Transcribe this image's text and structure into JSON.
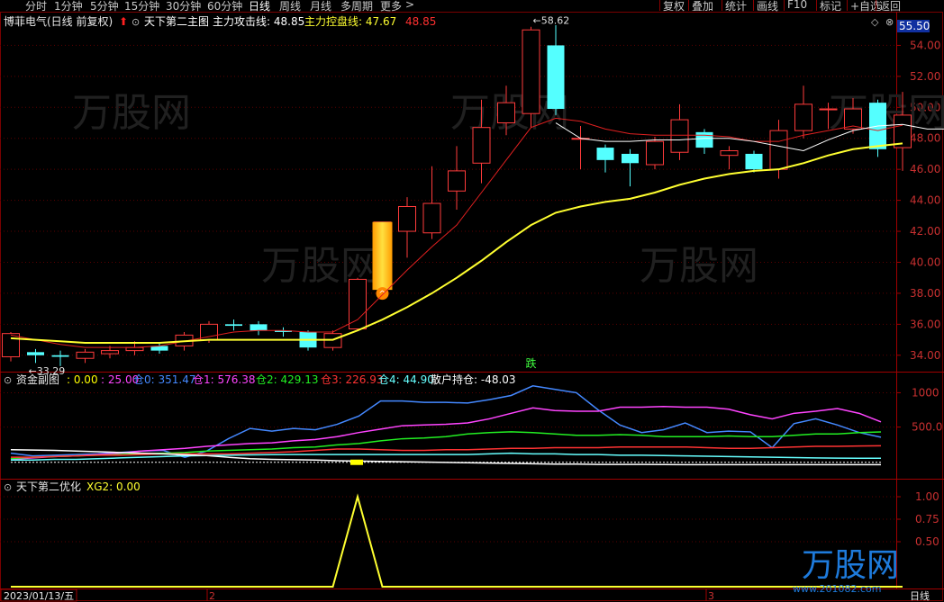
{
  "toolbar": {
    "tabs": [
      "分时",
      "1分钟",
      "5分钟",
      "15分钟",
      "30分钟",
      "60分钟",
      "日线",
      "周线",
      "月线",
      "多周期",
      "更多"
    ],
    "active_tab": "日线",
    "right_buttons": [
      "复权",
      "叠加",
      "统计",
      "画线",
      "F10",
      "标记",
      "+自选",
      "返回"
    ]
  },
  "main_panel": {
    "stock_title": "博菲电气(日线 前复权)",
    "indicator_name": "天下第二主图",
    "attack_label": "主力攻击线: 48.85",
    "control_label": "主力控盘线: 47.67",
    "extra_value": "48.85",
    "price_box": "55.50",
    "y_ticks": [
      "54.00",
      "52.00",
      "50.00",
      "48.00",
      "46.00",
      "44.00",
      "42.00",
      "40.00",
      "38.00",
      "36.00",
      "34.00"
    ],
    "high_note": "58.62",
    "low_note": "33.29",
    "signal_text": "跌"
  },
  "fund_panel": {
    "title": "资金副图",
    "items": [
      {
        "text": ": 0.00",
        "color": "#ffff00"
      },
      {
        "text": ": 25.00",
        "color": "#ff44ff"
      },
      {
        "text": "仓0: 351.47",
        "color": "#4488ff"
      },
      {
        "text": "仓1: 576.38",
        "color": "#ff44ff"
      },
      {
        "text": "仓2: 429.13",
        "color": "#22ee22"
      },
      {
        "text": "仓3: 226.93",
        "color": "#ff3333"
      },
      {
        "text": "仓4: 44.90",
        "color": "#66ffff"
      },
      {
        "text": "散户持仓: -48.03",
        "color": "#ffffff"
      }
    ],
    "y_ticks": [
      "1000",
      "500.0"
    ]
  },
  "opt_panel": {
    "title": "天下第二优化",
    "xg_label": "XG2: 0.00",
    "y_ticks": [
      "1.00",
      "0.75",
      "0.50"
    ]
  },
  "bottom_axis": {
    "date_label": "2023/01/13/五",
    "markers": [
      "2",
      "3"
    ],
    "period": "日线"
  },
  "watermark": {
    "brand": "万股网",
    "url": "www.201082.com"
  },
  "chart_data": {
    "type": "candlestick",
    "ylim": [
      33,
      56
    ],
    "candles": [
      {
        "o": 33.9,
        "c": 35.4,
        "h": 35.5,
        "l": 33.6
      },
      {
        "o": 34.2,
        "c": 34.0,
        "h": 34.4,
        "l": 33.5
      },
      {
        "o": 34.0,
        "c": 33.9,
        "h": 34.3,
        "l": 33.3
      },
      {
        "o": 33.8,
        "c": 34.2,
        "h": 34.4,
        "l": 33.5
      },
      {
        "o": 34.1,
        "c": 34.3,
        "h": 34.6,
        "l": 33.8
      },
      {
        "o": 34.3,
        "c": 34.5,
        "h": 34.9,
        "l": 34.0
      },
      {
        "o": 34.6,
        "c": 34.3,
        "h": 34.8,
        "l": 34.1
      },
      {
        "o": 34.6,
        "c": 35.3,
        "h": 35.5,
        "l": 34.3
      },
      {
        "o": 35.0,
        "c": 36.0,
        "h": 36.2,
        "l": 34.8
      },
      {
        "o": 36.0,
        "c": 35.9,
        "h": 36.3,
        "l": 35.6
      },
      {
        "o": 36.0,
        "c": 35.6,
        "h": 36.2,
        "l": 35.3
      },
      {
        "o": 35.6,
        "c": 35.5,
        "h": 35.8,
        "l": 35.2
      },
      {
        "o": 35.5,
        "c": 34.5,
        "h": 35.6,
        "l": 34.3
      },
      {
        "o": 34.5,
        "c": 35.4,
        "h": 35.6,
        "l": 34.3
      },
      {
        "o": 35.7,
        "c": 38.9,
        "h": 39.0,
        "l": 35.6
      },
      {
        "o": 38.8,
        "c": 42.6,
        "h": 42.6,
        "l": 38.5
      },
      {
        "o": 42.0,
        "c": 43.6,
        "h": 44.2,
        "l": 40.3
      },
      {
        "o": 41.9,
        "c": 43.8,
        "h": 46.2,
        "l": 41.5
      },
      {
        "o": 44.6,
        "c": 45.9,
        "h": 47.5,
        "l": 43.4
      },
      {
        "o": 46.4,
        "c": 48.7,
        "h": 50.5,
        "l": 45.1
      },
      {
        "o": 49.0,
        "c": 50.3,
        "h": 51.4,
        "l": 48.2
      },
      {
        "o": 49.6,
        "c": 55.0,
        "h": 55.2,
        "l": 48.7
      },
      {
        "o": 54.0,
        "c": 49.9,
        "h": 55.3,
        "l": 49.5
      },
      {
        "o": 48.0,
        "c": 48.0,
        "h": 48.8,
        "l": 46.0
      },
      {
        "o": 47.4,
        "c": 46.6,
        "h": 47.6,
        "l": 45.8
      },
      {
        "o": 47.0,
        "c": 46.4,
        "h": 47.3,
        "l": 44.9
      },
      {
        "o": 46.3,
        "c": 47.8,
        "h": 48.1,
        "l": 46.0
      },
      {
        "o": 47.1,
        "c": 49.2,
        "h": 50.2,
        "l": 46.6
      },
      {
        "o": 48.4,
        "c": 47.4,
        "h": 48.6,
        "l": 47.0
      },
      {
        "o": 46.9,
        "c": 47.2,
        "h": 47.5,
        "l": 46.0
      },
      {
        "o": 47.0,
        "c": 46.0,
        "h": 47.2,
        "l": 45.8
      },
      {
        "o": 46.0,
        "c": 48.5,
        "h": 49.2,
        "l": 45.4
      },
      {
        "o": 48.5,
        "c": 50.2,
        "h": 51.4,
        "l": 48.0
      },
      {
        "o": 49.9,
        "c": 49.9,
        "h": 50.3,
        "l": 48.6
      },
      {
        "o": 48.6,
        "c": 49.9,
        "h": 50.6,
        "l": 48.3
      },
      {
        "o": 50.3,
        "c": 47.3,
        "h": 50.5,
        "l": 46.8
      },
      {
        "o": 47.4,
        "c": 49.5,
        "h": 51.0,
        "l": 45.9
      }
    ],
    "attack_line": [
      35.3,
      35.0,
      34.7,
      34.5,
      34.5,
      34.5,
      34.6,
      34.9,
      35.2,
      35.5,
      35.6,
      35.6,
      35.5,
      35.5,
      36.3,
      37.9,
      39.5,
      41.0,
      42.4,
      44.5,
      46.6,
      48.7,
      49.3,
      49.1,
      48.6,
      48.3,
      48.2,
      48.2,
      48.2,
      48.1,
      47.8,
      47.8,
      48.2,
      48.5,
      48.8,
      48.5,
      48.85
    ],
    "control_line": [
      35.1,
      35.0,
      34.9,
      34.8,
      34.8,
      34.8,
      34.8,
      34.9,
      35.0,
      35.0,
      35.0,
      35.0,
      35.0,
      35.0,
      35.6,
      36.3,
      37.1,
      38.0,
      39.0,
      40.1,
      41.3,
      42.4,
      43.2,
      43.6,
      43.9,
      44.1,
      44.5,
      45.0,
      45.4,
      45.7,
      45.9,
      46.0,
      46.4,
      46.9,
      47.3,
      47.5,
      47.67
    ],
    "fund_ylim": [
      -200,
      1150
    ],
    "fund_series": [
      {
        "name": "仓0",
        "color": "#4488ff",
        "values": [
          120,
          80,
          90,
          100,
          110,
          130,
          150,
          160,
          60,
          150,
          330,
          480,
          440,
          480,
          460,
          540,
          660,
          880,
          880,
          860,
          860,
          850,
          900,
          960,
          1100,
          1050,
          1000,
          750,
          530,
          420,
          460,
          560,
          420,
          440,
          430,
          200,
          550,
          620,
          530,
          420,
          352
        ]
      },
      {
        "name": "仓1",
        "color": "#ff44ff",
        "values": [
          30,
          50,
          70,
          80,
          100,
          120,
          150,
          170,
          190,
          220,
          240,
          260,
          270,
          300,
          320,
          360,
          420,
          470,
          520,
          530,
          540,
          560,
          620,
          700,
          780,
          740,
          730,
          730,
          790,
          790,
          800,
          790,
          790,
          760,
          680,
          620,
          700,
          730,
          770,
          700,
          576
        ]
      },
      {
        "name": "仓2",
        "color": "#22ee22",
        "values": [
          40,
          60,
          70,
          80,
          90,
          100,
          110,
          120,
          130,
          150,
          160,
          170,
          180,
          200,
          210,
          240,
          260,
          300,
          330,
          340,
          360,
          400,
          420,
          430,
          420,
          400,
          380,
          380,
          390,
          380,
          360,
          360,
          360,
          370,
          360,
          360,
          380,
          400,
          400,
          420,
          429
        ]
      },
      {
        "name": "仓3",
        "color": "#ff3333",
        "values": [
          60,
          60,
          70,
          80,
          90,
          90,
          100,
          110,
          110,
          110,
          110,
          120,
          130,
          140,
          160,
          180,
          180,
          170,
          160,
          160,
          170,
          170,
          180,
          190,
          190,
          200,
          200,
          200,
          210,
          210,
          210,
          210,
          200,
          190,
          190,
          200,
          210,
          220,
          220,
          225,
          227
        ]
      },
      {
        "name": "仓4",
        "color": "#66ffff",
        "values": [
          20,
          20,
          30,
          30,
          40,
          50,
          60,
          70,
          80,
          85,
          90,
          95,
          98,
          100,
          100,
          100,
          100,
          100,
          100,
          100,
          100,
          100,
          110,
          120,
          110,
          110,
          100,
          100,
          90,
          90,
          85,
          80,
          75,
          70,
          65,
          60,
          55,
          50,
          48,
          46,
          45
        ]
      },
      {
        "name": "散户持仓",
        "color": "#ffffff",
        "values": [
          170,
          165,
          160,
          150,
          140,
          130,
          120,
          110,
          95,
          85,
          60,
          40,
          30,
          25,
          20,
          10,
          5,
          0,
          -5,
          -10,
          -15,
          -20,
          -25,
          -30,
          -35,
          -40,
          -40,
          -45,
          -45,
          -45,
          -46,
          -47,
          -47,
          -48,
          -48,
          -48,
          -48,
          -48,
          -48,
          -48,
          -48
        ]
      }
    ],
    "xg2": [
      0,
      0,
      0,
      0,
      0,
      0,
      0,
      0,
      0,
      0,
      0,
      0,
      0,
      0,
      1,
      0,
      0,
      0,
      0,
      0,
      0,
      0,
      0,
      0,
      0,
      0,
      0,
      0,
      0,
      0,
      0,
      0,
      0,
      0,
      0,
      0,
      0
    ]
  }
}
